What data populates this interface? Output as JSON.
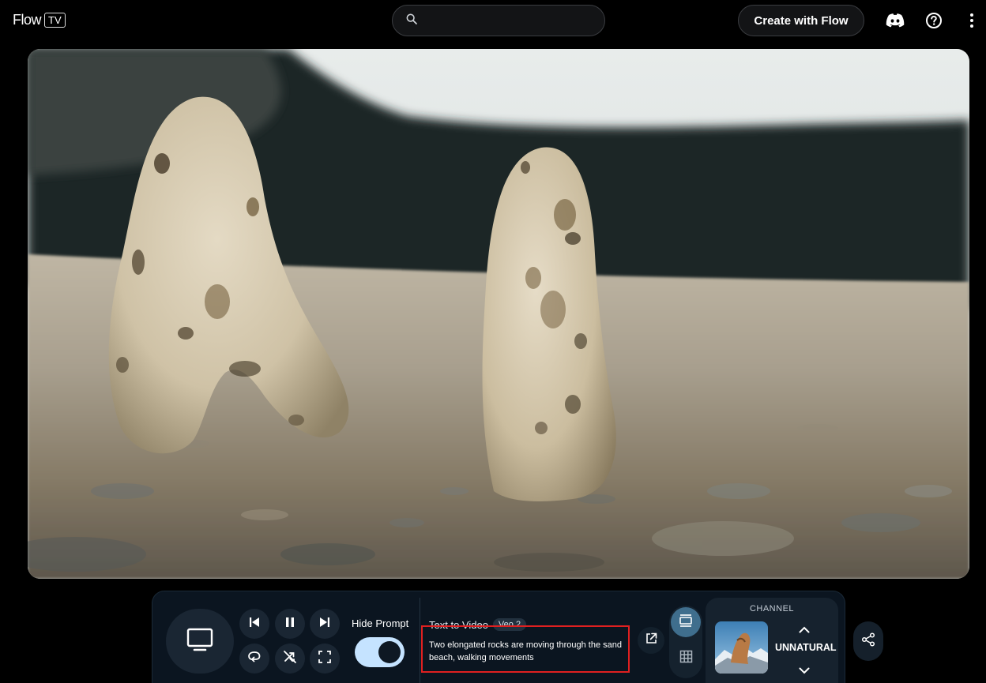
{
  "header": {
    "logo_text": "Flow",
    "logo_badge": "TV",
    "search_placeholder": "",
    "create_label": "Create with Flow",
    "icons": [
      "search-icon",
      "discord-icon",
      "help-icon",
      "more-vert-icon"
    ]
  },
  "player": {
    "hide_prompt_label": "Hide Prompt",
    "hide_prompt_on": true,
    "prompt_type": "Text to Video",
    "model_badge": "Veo 2",
    "prompt_text": "Two elongated rocks are moving through the sand beach, walking movements",
    "controls": [
      "tv-icon",
      "skip-previous-icon",
      "pause-icon",
      "skip-next-icon",
      "loop-icon",
      "shuffle-off-icon",
      "fullscreen-icon",
      "open-in-new-icon",
      "layout-single-icon",
      "grid-icon",
      "share-icon"
    ]
  },
  "channel": {
    "label": "CHANNEL",
    "name": "UNNATURAL"
  },
  "colors": {
    "background": "#000000",
    "panel": "#0b1520",
    "toggle_on": "#c5e3ff",
    "active_view": "#3f6e8d",
    "highlight_border": "#e02020"
  }
}
